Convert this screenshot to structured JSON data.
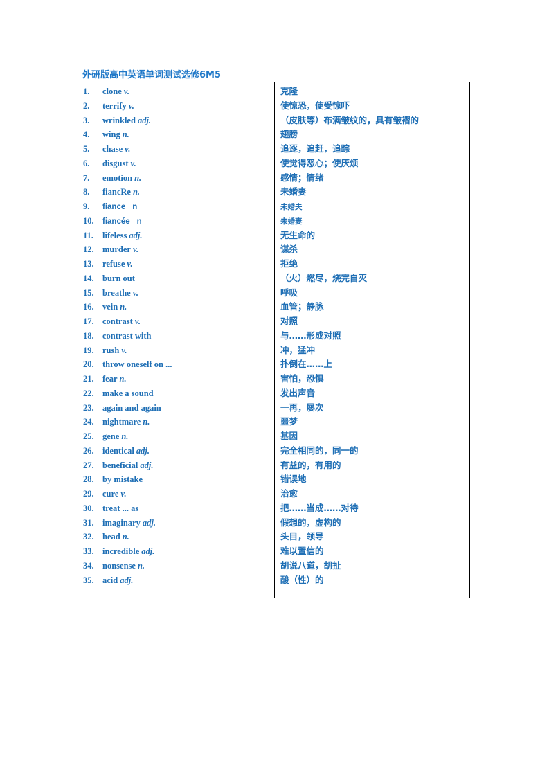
{
  "document": {
    "title": "外研版高中英语单词测试选修6M5",
    "text_color": "#1f6fb5",
    "title_color": "#1f78c8"
  },
  "vocab": [
    {
      "num": "1.",
      "term": "clone",
      "pos": "v.",
      "meaning": "克隆"
    },
    {
      "num": "2.",
      "term": "terrify",
      "pos": "v.",
      "meaning": "使惊恐，使受惊吓"
    },
    {
      "num": "3.",
      "term": "wrinkled",
      "pos": "adj.",
      "meaning": "（皮肤等）布满皱纹的，具有皱褶的"
    },
    {
      "num": "4.",
      "term": "wing",
      "pos": "n.",
      "meaning": "翅膀"
    },
    {
      "num": "5.",
      "term": "chase",
      "pos": "v.",
      "meaning": "追逐，追赶，追踪"
    },
    {
      "num": "6.",
      "term": "disgust",
      "pos": "v.",
      "meaning": "使觉得恶心；使厌烦"
    },
    {
      "num": "7.",
      "term": "emotion",
      "pos": "n.",
      "meaning": "感情；情绪"
    },
    {
      "num": "8.",
      "term": "fiancRe",
      "pos": "n.",
      "meaning": "未婚妻"
    },
    {
      "num": "9.",
      "term": "fiance",
      "pos": "n",
      "meaning": "未婚夫"
    },
    {
      "num": "10.",
      "term": "fiancée",
      "pos": "n",
      "meaning": "未婚妻"
    },
    {
      "num": "11.",
      "term": "lifeless",
      "pos": "adj.",
      "meaning": "无生命的"
    },
    {
      "num": "12.",
      "term": "murder",
      "pos": "v.",
      "meaning": "谋杀"
    },
    {
      "num": "13.",
      "term": "refuse",
      "pos": "v.",
      "meaning": "拒绝"
    },
    {
      "num": "14.",
      "term": "burn out",
      "pos": "",
      "meaning": "（火）燃尽，烧完自灭"
    },
    {
      "num": "15.",
      "term": "breathe",
      "pos": "v.",
      "meaning": "呼吸"
    },
    {
      "num": "16.",
      "term": "vein",
      "pos": "n.",
      "meaning": "血管；静脉"
    },
    {
      "num": "17.",
      "term": "contrast",
      "pos": "v.",
      "meaning": "对照"
    },
    {
      "num": "18.",
      "term": "contrast with",
      "pos": "",
      "meaning": "与……形成对照"
    },
    {
      "num": "19.",
      "term": "rush",
      "pos": "v.",
      "meaning": "冲，猛冲"
    },
    {
      "num": "20.",
      "term": "throw oneself on ...",
      "pos": "",
      "meaning": "扑倒在……上"
    },
    {
      "num": "21.",
      "term": "fear",
      "pos": "n.",
      "meaning": "害怕，恐惧"
    },
    {
      "num": "22.",
      "term": "make a sound",
      "pos": "",
      "meaning": "发出声音"
    },
    {
      "num": "23.",
      "term": "again and again",
      "pos": "",
      "meaning": "一再，屡次"
    },
    {
      "num": "24.",
      "term": "nightmare",
      "pos": "n.",
      "meaning": "噩梦"
    },
    {
      "num": "25.",
      "term": "gene",
      "pos": "n.",
      "meaning": "基因"
    },
    {
      "num": "26.",
      "term": "identical",
      "pos": "adj.",
      "meaning": "完全相同的，同一的"
    },
    {
      "num": "27.",
      "term": "beneficial",
      "pos": "adj.",
      "meaning": "有益的，有用的"
    },
    {
      "num": "28.",
      "term": "by mistake",
      "pos": "",
      "meaning": "错误地"
    },
    {
      "num": "29.",
      "term": "cure",
      "pos": "v.",
      "meaning": "治愈"
    },
    {
      "num": "30.",
      "term": "treat ... as",
      "pos": "",
      "meaning": "把……当成……对待"
    },
    {
      "num": "31.",
      "term": "imaginary",
      "pos": "adj.",
      "meaning": "假想的，虚构的"
    },
    {
      "num": "32.",
      "term": "head",
      "pos": "n.",
      "meaning": "头目，领导"
    },
    {
      "num": "33.",
      "term": "incredible",
      "pos": "adj.",
      "meaning": "难以置信的"
    },
    {
      "num": "34.",
      "term": "nonsense",
      "pos": "n.",
      "meaning": "胡说八道，胡扯"
    },
    {
      "num": "35.",
      "term": "acid",
      "pos": "adj.",
      "meaning": "酸（性）的"
    }
  ]
}
